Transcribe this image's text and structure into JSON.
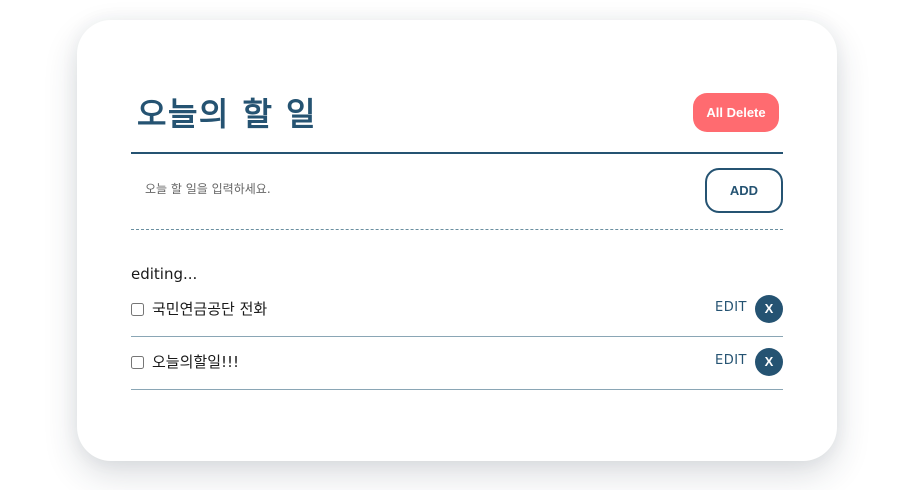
{
  "header": {
    "title": "오늘의 할 일",
    "all_delete_label": "All Delete"
  },
  "input": {
    "placeholder": "오늘 할 일을 입력하세요.",
    "value": "",
    "add_label": "ADD"
  },
  "status": {
    "editing_text": "editing..."
  },
  "todos": [
    {
      "text": "국민연금공단 전화",
      "checked": false,
      "edit_label": "EDIT",
      "delete_label": "X"
    },
    {
      "text": "오늘의할일!!!",
      "checked": false,
      "edit_label": "EDIT",
      "delete_label": "X"
    }
  ],
  "colors": {
    "primary": "#255372",
    "danger": "#ff6b70",
    "text": "#1a1a1a"
  }
}
